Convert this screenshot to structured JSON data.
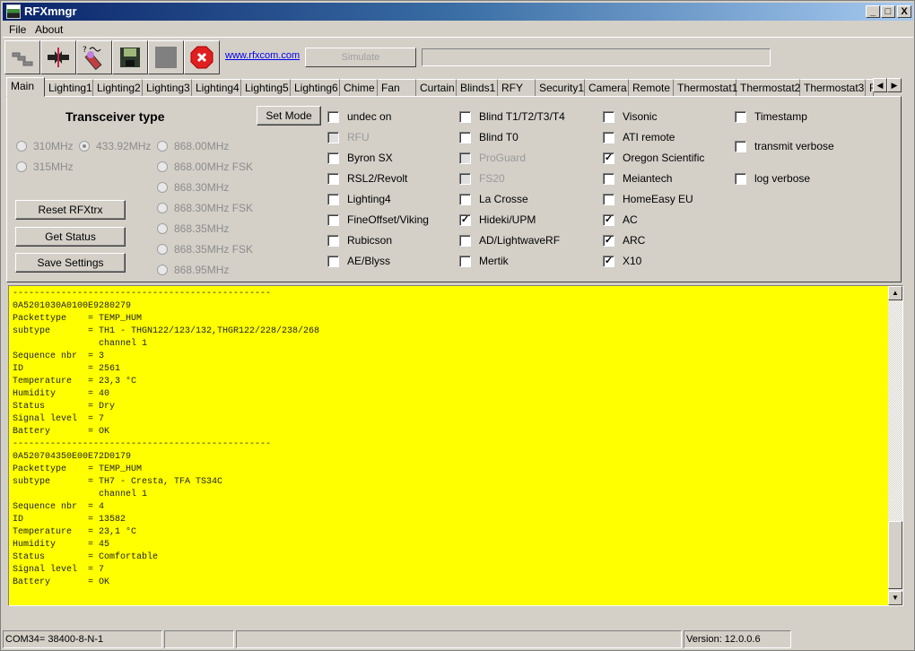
{
  "window": {
    "title": "RFXmngr",
    "controls": {
      "minimize": "_",
      "maximize": "□",
      "close": "X"
    }
  },
  "menu": [
    "File",
    "About"
  ],
  "toolbar": {
    "icons": [
      "connect-plug-icon",
      "disconnect-icon",
      "log-pen-icon",
      "save-floppy-icon",
      "stop-square-icon",
      "exit-stop-icon"
    ],
    "link": "www.rfxcom.com",
    "simulate_label": "Simulate"
  },
  "tabs": [
    "Main",
    "Lighting1",
    "Lighting2",
    "Lighting3",
    "Lighting4",
    "Lighting5",
    "Lighting6",
    "Chime",
    "Fan",
    "Curtain",
    "Blinds1",
    "RFY",
    "Security1",
    "Camera",
    "Remote",
    "Thermostat1",
    "Thermostat2",
    "Thermostat3",
    "F"
  ],
  "active_tab": "Main",
  "main": {
    "heading": "Transceiver type",
    "set_mode": "Set Mode",
    "buttons": {
      "reset": "Reset RFXtrx",
      "status": "Get Status",
      "save": "Save Settings"
    },
    "frequencies": [
      {
        "label": "310MHz",
        "selected": false
      },
      {
        "label": "433.92MHz",
        "selected": true
      },
      {
        "label": "315MHz",
        "selected": false
      },
      {
        "label": "868.00MHz",
        "selected": false
      },
      {
        "label": "868.00MHz FSK",
        "selected": false
      },
      {
        "label": "868.30MHz",
        "selected": false
      },
      {
        "label": "868.30MHz FSK",
        "selected": false
      },
      {
        "label": "868.35MHz",
        "selected": false
      },
      {
        "label": "868.35MHz FSK",
        "selected": false
      },
      {
        "label": "868.95MHz",
        "selected": false
      }
    ],
    "protocols_col1": [
      {
        "label": "undec on",
        "checked": false,
        "enabled": true
      },
      {
        "label": "RFU",
        "checked": false,
        "enabled": false
      },
      {
        "label": "Byron SX",
        "checked": false,
        "enabled": true
      },
      {
        "label": "RSL2/Revolt",
        "checked": false,
        "enabled": true
      },
      {
        "label": "Lighting4",
        "checked": false,
        "enabled": true
      },
      {
        "label": "FineOffset/Viking",
        "checked": false,
        "enabled": true
      },
      {
        "label": "Rubicson",
        "checked": false,
        "enabled": true
      },
      {
        "label": "AE/Blyss",
        "checked": false,
        "enabled": true
      }
    ],
    "protocols_col2": [
      {
        "label": "Blind T1/T2/T3/T4",
        "checked": false,
        "enabled": true
      },
      {
        "label": "Blind T0",
        "checked": false,
        "enabled": true
      },
      {
        "label": "ProGuard",
        "checked": false,
        "enabled": false
      },
      {
        "label": "FS20",
        "checked": false,
        "enabled": false
      },
      {
        "label": "La Crosse",
        "checked": false,
        "enabled": true
      },
      {
        "label": "Hideki/UPM",
        "checked": true,
        "enabled": true
      },
      {
        "label": "AD/LightwaveRF",
        "checked": false,
        "enabled": true
      },
      {
        "label": "Mertik",
        "checked": false,
        "enabled": true
      }
    ],
    "protocols_col3": [
      {
        "label": "Visonic",
        "checked": false,
        "enabled": true
      },
      {
        "label": "ATI remote",
        "checked": false,
        "enabled": true
      },
      {
        "label": "Oregon Scientific",
        "checked": true,
        "enabled": true
      },
      {
        "label": "Meiantech",
        "checked": false,
        "enabled": true
      },
      {
        "label": "HomeEasy EU",
        "checked": false,
        "enabled": true
      },
      {
        "label": "AC",
        "checked": true,
        "enabled": true
      },
      {
        "label": "ARC",
        "checked": true,
        "enabled": true
      },
      {
        "label": "X10",
        "checked": true,
        "enabled": true
      }
    ],
    "options": [
      {
        "label": "Timestamp",
        "checked": false
      },
      {
        "label": "transmit verbose",
        "checked": false
      },
      {
        "label": "log verbose",
        "checked": false
      }
    ]
  },
  "log_text": "------------------------------------------------\n0A5201030A0100E9280279\nPackettype    = TEMP_HUM\nsubtype       = TH1 - THGN122/123/132,THGR122/228/238/268\n                channel 1\nSequence nbr  = 3\nID            = 2561\nTemperature   = 23,3 °C\nHumidity      = 40\nStatus        = Dry\nSignal level  = 7\nBattery       = OK\n------------------------------------------------\n0A520704350E00E72D0179\nPackettype    = TEMP_HUM\nsubtype       = TH7 - Cresta, TFA TS34C\n                channel 1\nSequence nbr  = 4\nID            = 13582\nTemperature   = 23,1 °C\nHumidity      = 45\nStatus        = Comfortable\nSignal level  = 7\nBattery       = OK",
  "status": {
    "port": "COM34= 38400-8-N-1",
    "panel2": "",
    "panel3": "",
    "version": "Version: 12.0.0.6"
  },
  "colors": {
    "log_bg": "#ffff00",
    "titlebar_start": "#0a246a",
    "titlebar_end": "#a6caf0"
  }
}
